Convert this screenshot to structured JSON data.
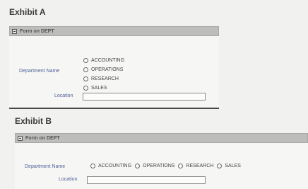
{
  "exhibit_a": {
    "title": "Exhibit A",
    "panel_title": "Form on DEPT",
    "department_label": "Department Name",
    "options": [
      "ACCOUNTING",
      "OPERATIONS",
      "RESEARCH",
      "SALES"
    ],
    "location_label": "Location",
    "location_value": ""
  },
  "exhibit_b": {
    "title": "Exhibit B",
    "panel_title": "Form on DEPT",
    "department_label": "Department Name",
    "options": [
      "ACCOUNTING",
      "OPERATIONS",
      "RESEARCH",
      "SALES"
    ],
    "location_label": "Location",
    "location_value": ""
  }
}
